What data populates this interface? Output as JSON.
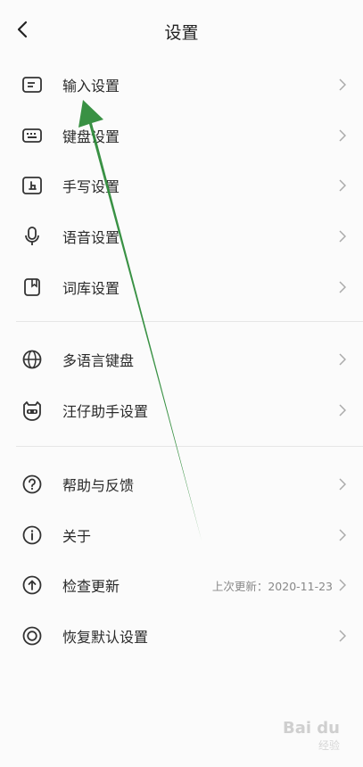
{
  "header": {
    "title": "设置"
  },
  "group1": [
    {
      "label": "输入设置",
      "icon": "input-box-icon"
    },
    {
      "label": "键盘设置",
      "icon": "keyboard-icon"
    },
    {
      "label": "手写设置",
      "icon": "handwriting-icon"
    },
    {
      "label": "语音设置",
      "icon": "microphone-icon"
    },
    {
      "label": "词库设置",
      "icon": "dictionary-icon"
    }
  ],
  "group2": [
    {
      "label": "多语言键盘",
      "icon": "globe-icon"
    },
    {
      "label": "汪仔助手设置",
      "icon": "mascot-icon"
    }
  ],
  "group3": [
    {
      "label": "帮助与反馈",
      "icon": "help-icon"
    },
    {
      "label": "关于",
      "icon": "info-icon"
    },
    {
      "label": "检查更新",
      "icon": "upload-arrow-icon",
      "meta": "上次更新：2020-11-23"
    },
    {
      "label": "恢复默认设置",
      "icon": "restore-circle-icon"
    }
  ],
  "watermark": {
    "brand": "Bai du",
    "sub": "经验"
  },
  "colors": {
    "annotation_arrow": "#2e8b3a"
  }
}
